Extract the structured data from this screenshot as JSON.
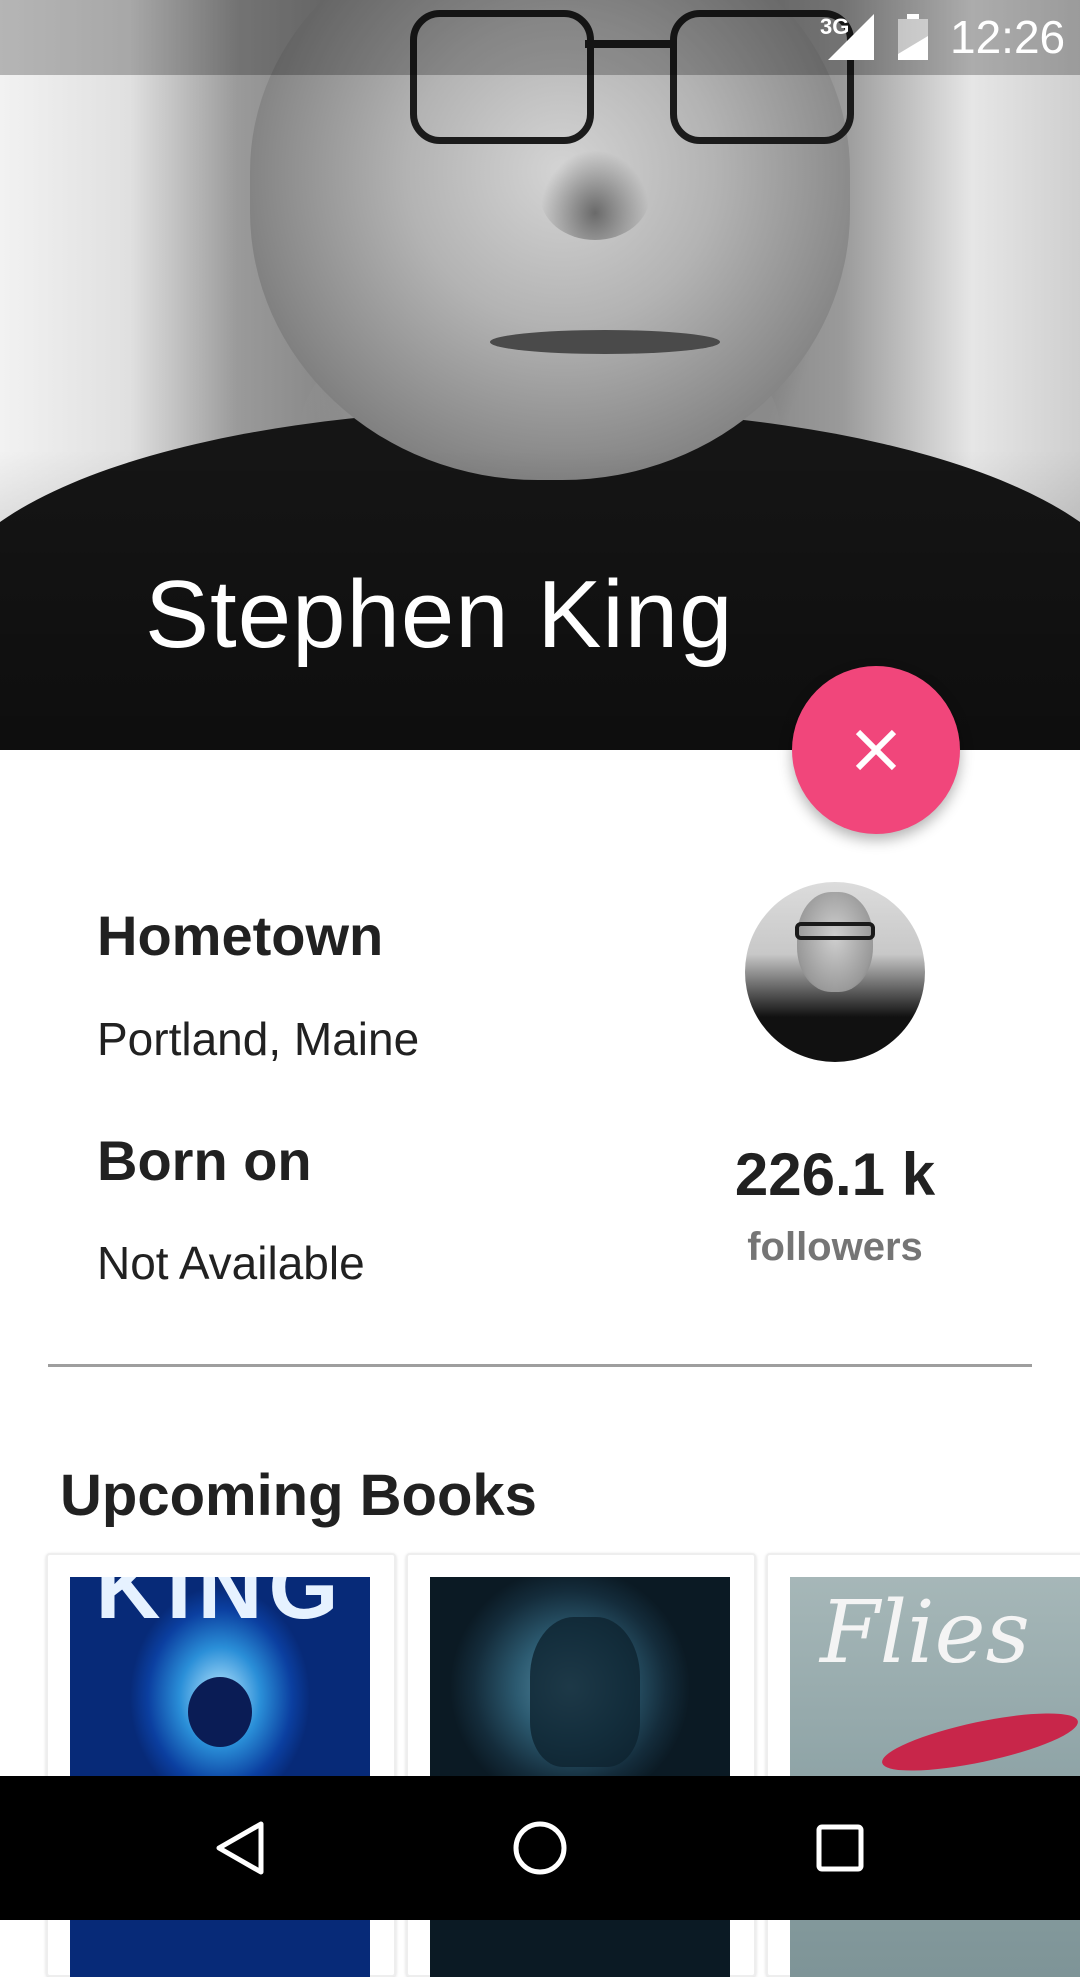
{
  "status_bar": {
    "network": "3G",
    "time": "12:26"
  },
  "header": {
    "author_name": "Stephen King"
  },
  "fab": {
    "icon": "close-icon",
    "color": "#f1467b"
  },
  "info": {
    "hometown_label": "Hometown",
    "hometown_value": "Portland, Maine",
    "born_label": "Born on",
    "born_value": "Not Available",
    "followers_count": "226.1 k",
    "followers_label": "followers"
  },
  "upcoming": {
    "title": "Upcoming Books",
    "books": [
      {
        "cover_text": "KING"
      },
      {
        "cover_text": ""
      },
      {
        "cover_text": "Flies"
      }
    ]
  },
  "nav_bar": {
    "back_icon": "back-triangle-icon",
    "home_icon": "home-circle-icon",
    "recent_icon": "recent-square-icon"
  }
}
